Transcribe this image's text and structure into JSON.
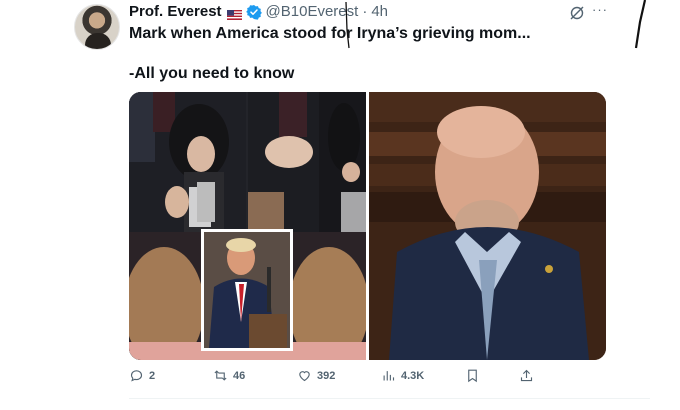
{
  "author": {
    "name": "Prof. Everest",
    "flag_icon": "us-flag-icon",
    "verified_icon": "verified-badge-icon",
    "handle": "@B10Everest",
    "separator": "·",
    "time": "4h"
  },
  "tweet": {
    "line1": "Mark when America stood for Iryna’s grieving mom...",
    "line2": "-All you need to know"
  },
  "actions": {
    "replies": "2",
    "retweets": "46",
    "likes": "392",
    "views": "4.3K"
  },
  "colors": {
    "verified": "#1d9bf0",
    "secondary_text": "#536471",
    "primary_text": "#0f1419"
  }
}
